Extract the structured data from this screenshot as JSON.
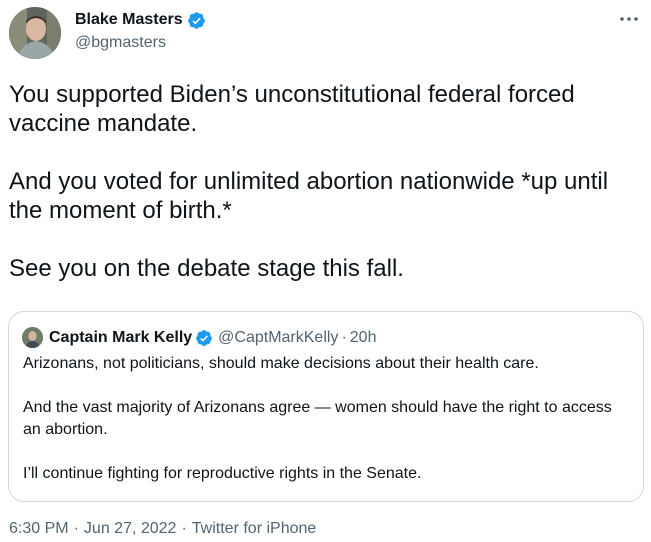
{
  "author": {
    "name": "Blake Masters",
    "handle": "@bgmasters"
  },
  "tweet": {
    "paragraphs": [
      "You supported Biden’s unconstitutional federal forced vaccine mandate.",
      "And you voted for unlimited abortion nationwide *up until the moment of birth.*",
      "See you on the debate stage this fall."
    ]
  },
  "quote": {
    "name": "Captain Mark Kelly",
    "handle": "@CaptMarkKelly",
    "separator": "·",
    "time": "20h",
    "paragraphs": [
      "Arizonans, not politicians, should make decisions about their health care.",
      "And the vast majority of Arizonans agree — women should have the right to access an abortion.",
      "I’ll continue fighting for reproductive rights in the Senate."
    ]
  },
  "meta": {
    "time": "6:30 PM",
    "date": "Jun 27, 2022",
    "source": "Twitter for iPhone",
    "separator": "·"
  },
  "colors": {
    "verified": "#1d9bf0",
    "text": "#0f1419",
    "secondary": "#536471",
    "border": "#cfd9de"
  },
  "icons": {
    "verified": "verified-badge-icon",
    "more": "more-options-icon"
  }
}
